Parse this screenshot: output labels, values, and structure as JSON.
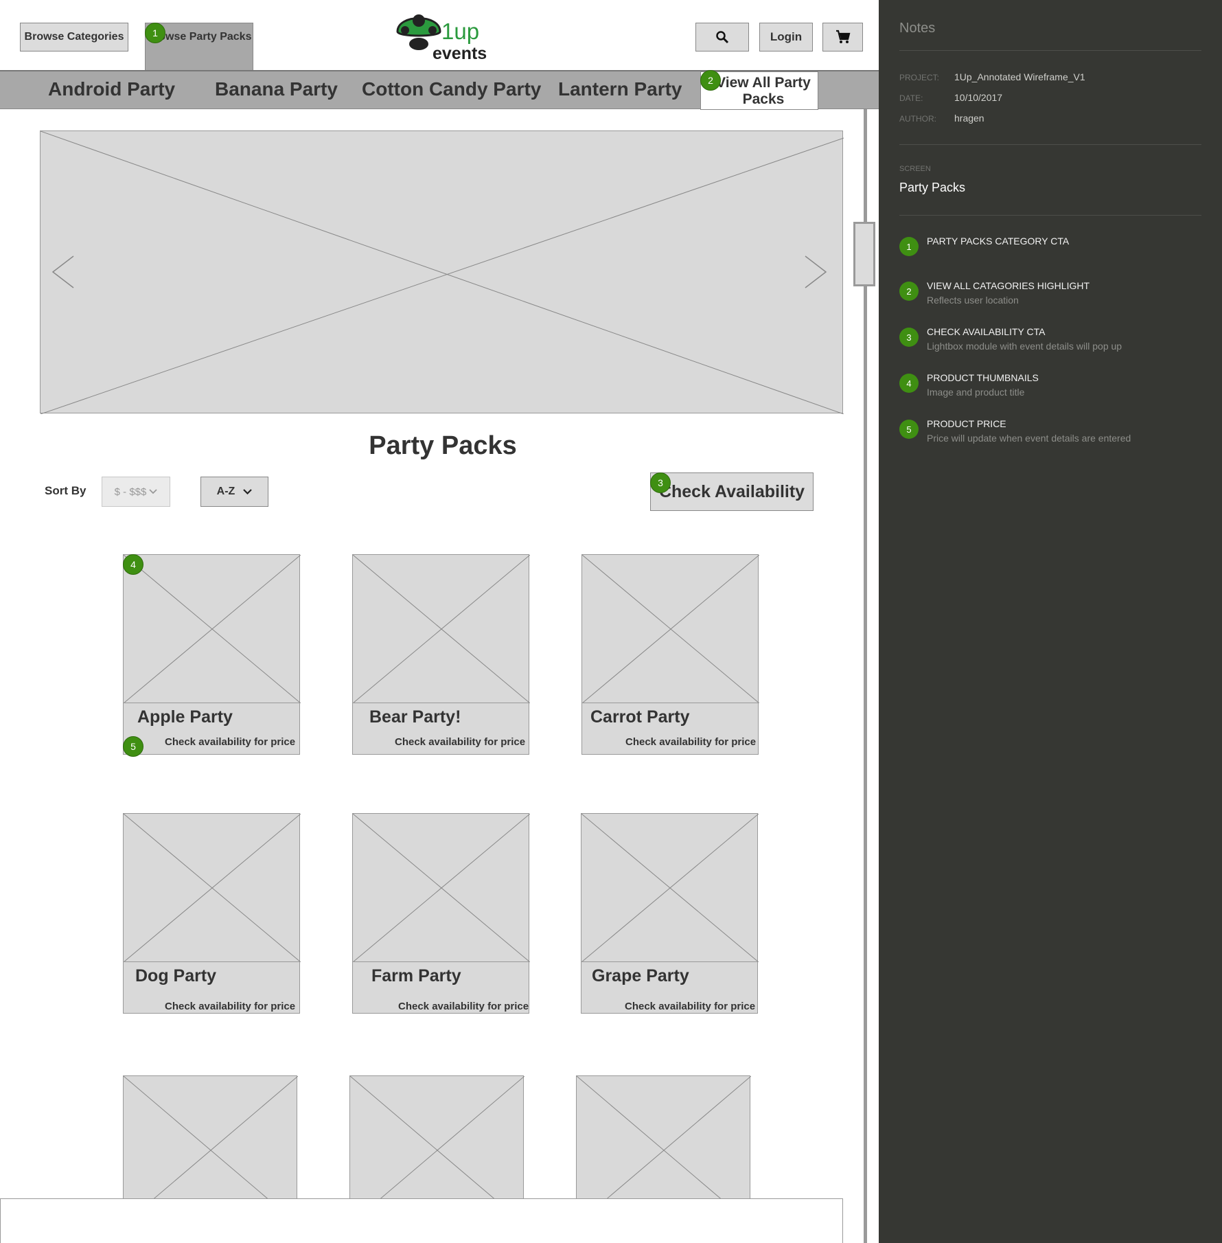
{
  "header": {
    "browse_categories": "Browse Categories",
    "browse_party_packs": "Browse Party Packs",
    "logo_top": "1up",
    "logo_bottom": "events",
    "login": "Login"
  },
  "nav": {
    "items": [
      "Android Party",
      "Banana Party",
      "Cotton Candy Party",
      "Lantern Party"
    ],
    "view_all": "View All Party Packs"
  },
  "main": {
    "title": "Party Packs",
    "sort_by_label": "Sort By",
    "price_sort": "$ - $$$",
    "alpha_sort": "A-Z",
    "check_availability": "Check Availability"
  },
  "products": [
    {
      "title": "Apple Party",
      "price": "Check availability for price"
    },
    {
      "title": "Bear Party!",
      "price": "Check availability for price"
    },
    {
      "title": "Carrot Party",
      "price": "Check availability for price"
    },
    {
      "title": "Dog Party",
      "price": "Check availability for price"
    },
    {
      "title": "Farm Party",
      "price": "Check availability for price"
    },
    {
      "title": "Grape Party",
      "price": "Check availability for price"
    }
  ],
  "badges": [
    "1",
    "2",
    "3",
    "4",
    "5"
  ],
  "notes": {
    "heading": "Notes",
    "project_label": "PROJECT:",
    "project_value": "1Up_Annotated Wireframe_V1",
    "date_label": "DATE:",
    "date_value": "10/10/2017",
    "author_label": "AUTHOR:",
    "author_value": "hragen",
    "screen_label": "SCREEN",
    "screen_value": "Party Packs",
    "items": [
      {
        "num": "1",
        "title": "PARTY PACKS CATEGORY CTA",
        "desc": ""
      },
      {
        "num": "2",
        "title": "VIEW ALL CATAGORIES HIGHLIGHT",
        "desc": "Reflects user location"
      },
      {
        "num": "3",
        "title": "CHECK AVAILABILITY CTA",
        "desc": "Lightbox module with event details will pop up"
      },
      {
        "num": "4",
        "title": "PRODUCT THUMBNAILS",
        "desc": "Image and product title"
      },
      {
        "num": "5",
        "title": "PRODUCT PRICE",
        "desc": "Price will update when event details are entered"
      }
    ]
  },
  "colors": {
    "accent_green": "#3f8f12",
    "logo_green": "#2b9a3e",
    "notes_bg": "#363733",
    "placeholder_gray": "#d9d9d9"
  }
}
